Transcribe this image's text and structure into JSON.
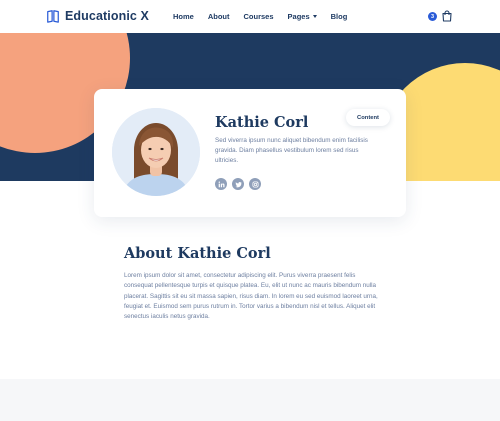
{
  "header": {
    "logo_text": "Educationic X",
    "nav": [
      {
        "label": "Home"
      },
      {
        "label": "About"
      },
      {
        "label": "Courses"
      },
      {
        "label": "Pages"
      },
      {
        "label": "Blog"
      }
    ],
    "counter": "3",
    "icons": {
      "logo": "book-icon",
      "cart": "shopping-bag-icon",
      "pages_dropdown": "caret-down-icon"
    }
  },
  "colors": {
    "navy": "#1e3a60",
    "orange": "#f5a27e",
    "yellow": "#fddb73",
    "accent_blue": "#2a5bd7",
    "body_text": "#6d7fa0"
  },
  "profile": {
    "name": "Kathie Corl",
    "bio": "Sed viverra ipsum nunc aliquet bibendum enim facilisis gravida. Diam phasellus vestibulum lorem sed risus ultricies.",
    "content_button": "Content",
    "socials": [
      {
        "icon": "linkedin-icon"
      },
      {
        "icon": "twitter-icon"
      },
      {
        "icon": "instagram-icon"
      }
    ]
  },
  "about": {
    "title": "About Kathie Corl",
    "text": "Lorem ipsum dolor sit amet, consectetur adipiscing elit. Purus viverra praesent felis consequat pellentesque turpis et quisque platea. Eu, elit ut nunc ac mauris bibendum nulla placerat. Sagittis sit eu sit massa sapien, risus diam. In lorem eu sed euismod laoreet urna, feugiat et. Euismod sem purus rutrum in. Tortor varius a bibendum nisl et tellus. Aliquet elit senectus iaculis netus gravida."
  }
}
